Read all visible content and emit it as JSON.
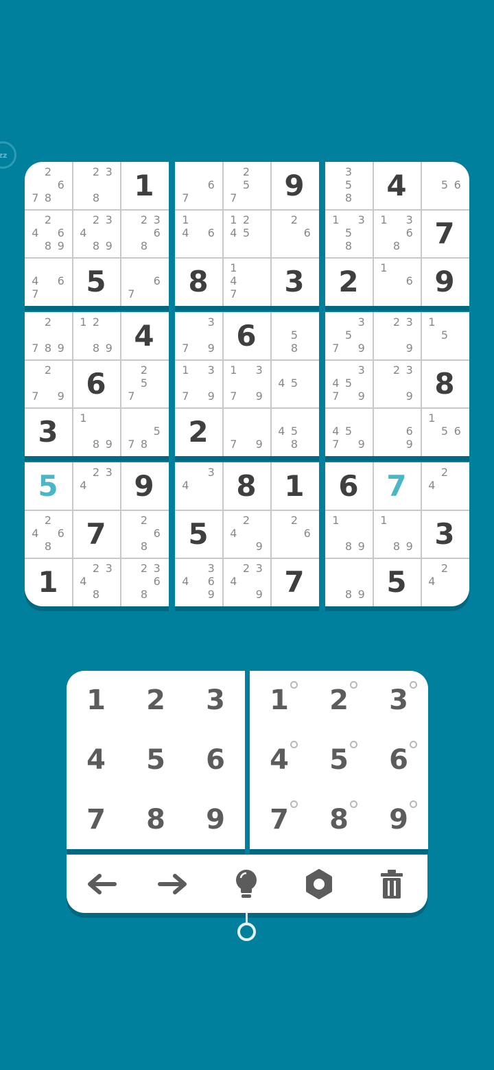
{
  "colors": {
    "background": "#01809e",
    "given_digit": "#3f3f3f",
    "player_digit": "#4cb7c4",
    "note_digit": "#888888",
    "panel": "#ffffff"
  },
  "sleep_badge": {
    "label": "zz",
    "icon": "sleep-icon"
  },
  "board": {
    "rows": [
      [
        {
          "notes": [
            "",
            "2",
            "",
            "",
            "",
            "6",
            "7",
            "8",
            ""
          ]
        },
        {
          "notes": [
            "",
            "2",
            "3",
            "",
            "",
            "",
            "",
            "8",
            ""
          ]
        },
        {
          "value": "1"
        },
        {
          "notes": [
            "",
            "",
            "",
            "",
            "",
            "6",
            "7",
            "",
            ""
          ]
        },
        {
          "notes": [
            "",
            "2",
            "",
            "",
            "5",
            "",
            "7",
            "",
            ""
          ]
        },
        {
          "value": "9"
        },
        {
          "notes": [
            "",
            "3",
            "",
            "",
            "5",
            "",
            "",
            "8",
            ""
          ]
        },
        {
          "value": "4"
        },
        {
          "notes": [
            "",
            "",
            "",
            "",
            "5",
            "6",
            "",
            "",
            ""
          ]
        }
      ],
      [
        {
          "notes": [
            "",
            "2",
            "",
            "4",
            "",
            "6",
            "",
            "8",
            "9"
          ]
        },
        {
          "notes": [
            "",
            "2",
            "3",
            "4",
            "",
            "",
            "",
            "8",
            "9"
          ]
        },
        {
          "notes": [
            "",
            "2",
            "3",
            "",
            "",
            "6",
            "",
            "8",
            ""
          ]
        },
        {
          "notes": [
            "1",
            "",
            "",
            "4",
            "",
            "6",
            "",
            "",
            ""
          ]
        },
        {
          "notes": [
            "1",
            "2",
            "",
            "4",
            "5",
            "",
            "",
            "",
            ""
          ]
        },
        {
          "notes": [
            "",
            "2",
            "",
            "",
            "",
            "6",
            "",
            "",
            ""
          ]
        },
        {
          "notes": [
            "1",
            "",
            "3",
            "",
            "5",
            "",
            "",
            "8",
            ""
          ]
        },
        {
          "notes": [
            "1",
            "",
            "3",
            "",
            "",
            "6",
            "",
            "8",
            ""
          ]
        },
        {
          "value": "7"
        }
      ],
      [
        {
          "notes": [
            "",
            "",
            "",
            "4",
            "",
            "6",
            "7",
            "",
            ""
          ]
        },
        {
          "value": "5"
        },
        {
          "notes": [
            "",
            "",
            "",
            "",
            "",
            "6",
            "7",
            "",
            ""
          ]
        },
        {
          "value": "8"
        },
        {
          "notes": [
            "1",
            "",
            "",
            "4",
            "",
            "",
            "7",
            "",
            ""
          ]
        },
        {
          "value": "3"
        },
        {
          "value": "2"
        },
        {
          "notes": [
            "1",
            "",
            "",
            "",
            "",
            "6",
            "",
            "",
            ""
          ]
        },
        {
          "value": "9"
        }
      ],
      [
        {
          "notes": [
            "",
            "2",
            "",
            "",
            "",
            "",
            "7",
            "8",
            "9"
          ]
        },
        {
          "notes": [
            "1",
            "2",
            "",
            "",
            "",
            "",
            "",
            "8",
            "9"
          ]
        },
        {
          "value": "4"
        },
        {
          "notes": [
            "",
            "",
            "3",
            "",
            "",
            "",
            "7",
            "",
            "9"
          ]
        },
        {
          "value": "6"
        },
        {
          "notes": [
            "",
            "",
            "",
            "",
            "5",
            "",
            "",
            "8",
            ""
          ]
        },
        {
          "notes": [
            "",
            "",
            "3",
            "",
            "5",
            "",
            "7",
            "",
            "9"
          ]
        },
        {
          "notes": [
            "",
            "2",
            "3",
            "",
            "",
            "",
            "",
            "",
            "9"
          ]
        },
        {
          "notes": [
            "1",
            "",
            "",
            "",
            "5",
            "",
            "",
            "",
            ""
          ]
        }
      ],
      [
        {
          "notes": [
            "",
            "2",
            "",
            "",
            "",
            "",
            "7",
            "",
            "9"
          ]
        },
        {
          "value": "6"
        },
        {
          "notes": [
            "",
            "2",
            "",
            "",
            "5",
            "",
            "7",
            "",
            ""
          ]
        },
        {
          "notes": [
            "1",
            "",
            "3",
            "",
            "",
            "",
            "7",
            "",
            "9"
          ]
        },
        {
          "notes": [
            "1",
            "",
            "3",
            "",
            "",
            "",
            "7",
            "",
            "9"
          ]
        },
        {
          "notes": [
            "",
            "",
            "",
            "4",
            "5",
            "",
            "",
            "",
            ""
          ]
        },
        {
          "notes": [
            "",
            "",
            "3",
            "4",
            "5",
            "",
            "7",
            "",
            "9"
          ]
        },
        {
          "notes": [
            "",
            "2",
            "3",
            "",
            "",
            "",
            "",
            "",
            "9"
          ]
        },
        {
          "value": "8"
        }
      ],
      [
        {
          "value": "3"
        },
        {
          "notes": [
            "1",
            "",
            "",
            "",
            "",
            "",
            "",
            "8",
            "9"
          ]
        },
        {
          "notes": [
            "",
            "",
            "",
            "",
            "",
            "5",
            "7",
            "8",
            ""
          ]
        },
        {
          "value": "2"
        },
        {
          "notes": [
            "",
            "",
            "",
            "",
            "",
            "",
            "7",
            "",
            "9"
          ]
        },
        {
          "notes": [
            "",
            "",
            "",
            "4",
            "5",
            "",
            "",
            "8",
            ""
          ]
        },
        {
          "notes": [
            "",
            "",
            "",
            "4",
            "5",
            "",
            "7",
            "",
            "9"
          ]
        },
        {
          "notes": [
            "",
            "",
            "",
            "",
            "",
            "6",
            "",
            "",
            "9"
          ]
        },
        {
          "notes": [
            "1",
            "",
            "",
            "",
            "5",
            "6",
            "",
            "",
            ""
          ]
        }
      ],
      [
        {
          "value": "5",
          "player": true
        },
        {
          "notes": [
            "",
            "2",
            "3",
            "4",
            "",
            "",
            "",
            "",
            ""
          ]
        },
        {
          "value": "9"
        },
        {
          "notes": [
            "",
            "",
            "3",
            "4",
            "",
            "",
            "",
            "",
            ""
          ]
        },
        {
          "value": "8"
        },
        {
          "value": "1"
        },
        {
          "value": "6"
        },
        {
          "value": "7",
          "player": true
        },
        {
          "notes": [
            "",
            "2",
            "",
            "4",
            "",
            "",
            "",
            "",
            ""
          ]
        }
      ],
      [
        {
          "notes": [
            "",
            "2",
            "",
            "4",
            "",
            "6",
            "",
            "8",
            ""
          ]
        },
        {
          "value": "7"
        },
        {
          "notes": [
            "",
            "2",
            "",
            "",
            "",
            "6",
            "",
            "8",
            ""
          ]
        },
        {
          "value": "5"
        },
        {
          "notes": [
            "",
            "2",
            "",
            "4",
            "",
            "",
            "",
            "",
            "9"
          ]
        },
        {
          "notes": [
            "",
            "2",
            "",
            "",
            "",
            "6",
            "",
            "",
            ""
          ]
        },
        {
          "notes": [
            "1",
            "",
            "",
            "",
            "",
            "",
            "",
            "8",
            "9"
          ]
        },
        {
          "notes": [
            "1",
            "",
            "",
            "",
            "",
            "",
            "",
            "8",
            "9"
          ]
        },
        {
          "value": "3"
        }
      ],
      [
        {
          "value": "1"
        },
        {
          "notes": [
            "",
            "2",
            "3",
            "4",
            "",
            "",
            "",
            "8",
            ""
          ]
        },
        {
          "notes": [
            "",
            "2",
            "3",
            "",
            "",
            "6",
            "",
            "8",
            ""
          ]
        },
        {
          "notes": [
            "",
            "",
            "3",
            "4",
            "",
            "6",
            "",
            "",
            "9"
          ]
        },
        {
          "notes": [
            "",
            "2",
            "3",
            "4",
            "",
            "",
            "",
            "",
            "9"
          ]
        },
        {
          "value": "7"
        },
        {
          "notes": [
            "",
            "",
            "",
            "",
            "",
            "",
            "",
            "8",
            "9"
          ]
        },
        {
          "value": "5"
        },
        {
          "notes": [
            "",
            "2",
            "",
            "4",
            "",
            "",
            "",
            "",
            ""
          ]
        }
      ]
    ]
  },
  "number_pad": {
    "digits": [
      "1",
      "2",
      "3",
      "4",
      "5",
      "6",
      "7",
      "8",
      "9"
    ],
    "note_digits": [
      "1",
      "2",
      "3",
      "4",
      "5",
      "6",
      "7",
      "8",
      "9"
    ]
  },
  "toolbar": {
    "items": [
      {
        "name": "undo-button",
        "icon": "arrow-left-icon"
      },
      {
        "name": "redo-button",
        "icon": "arrow-right-icon"
      },
      {
        "name": "hint-button",
        "icon": "lightbulb-icon"
      },
      {
        "name": "settings-button",
        "icon": "gear-icon"
      },
      {
        "name": "erase-button",
        "icon": "trash-icon"
      }
    ]
  }
}
